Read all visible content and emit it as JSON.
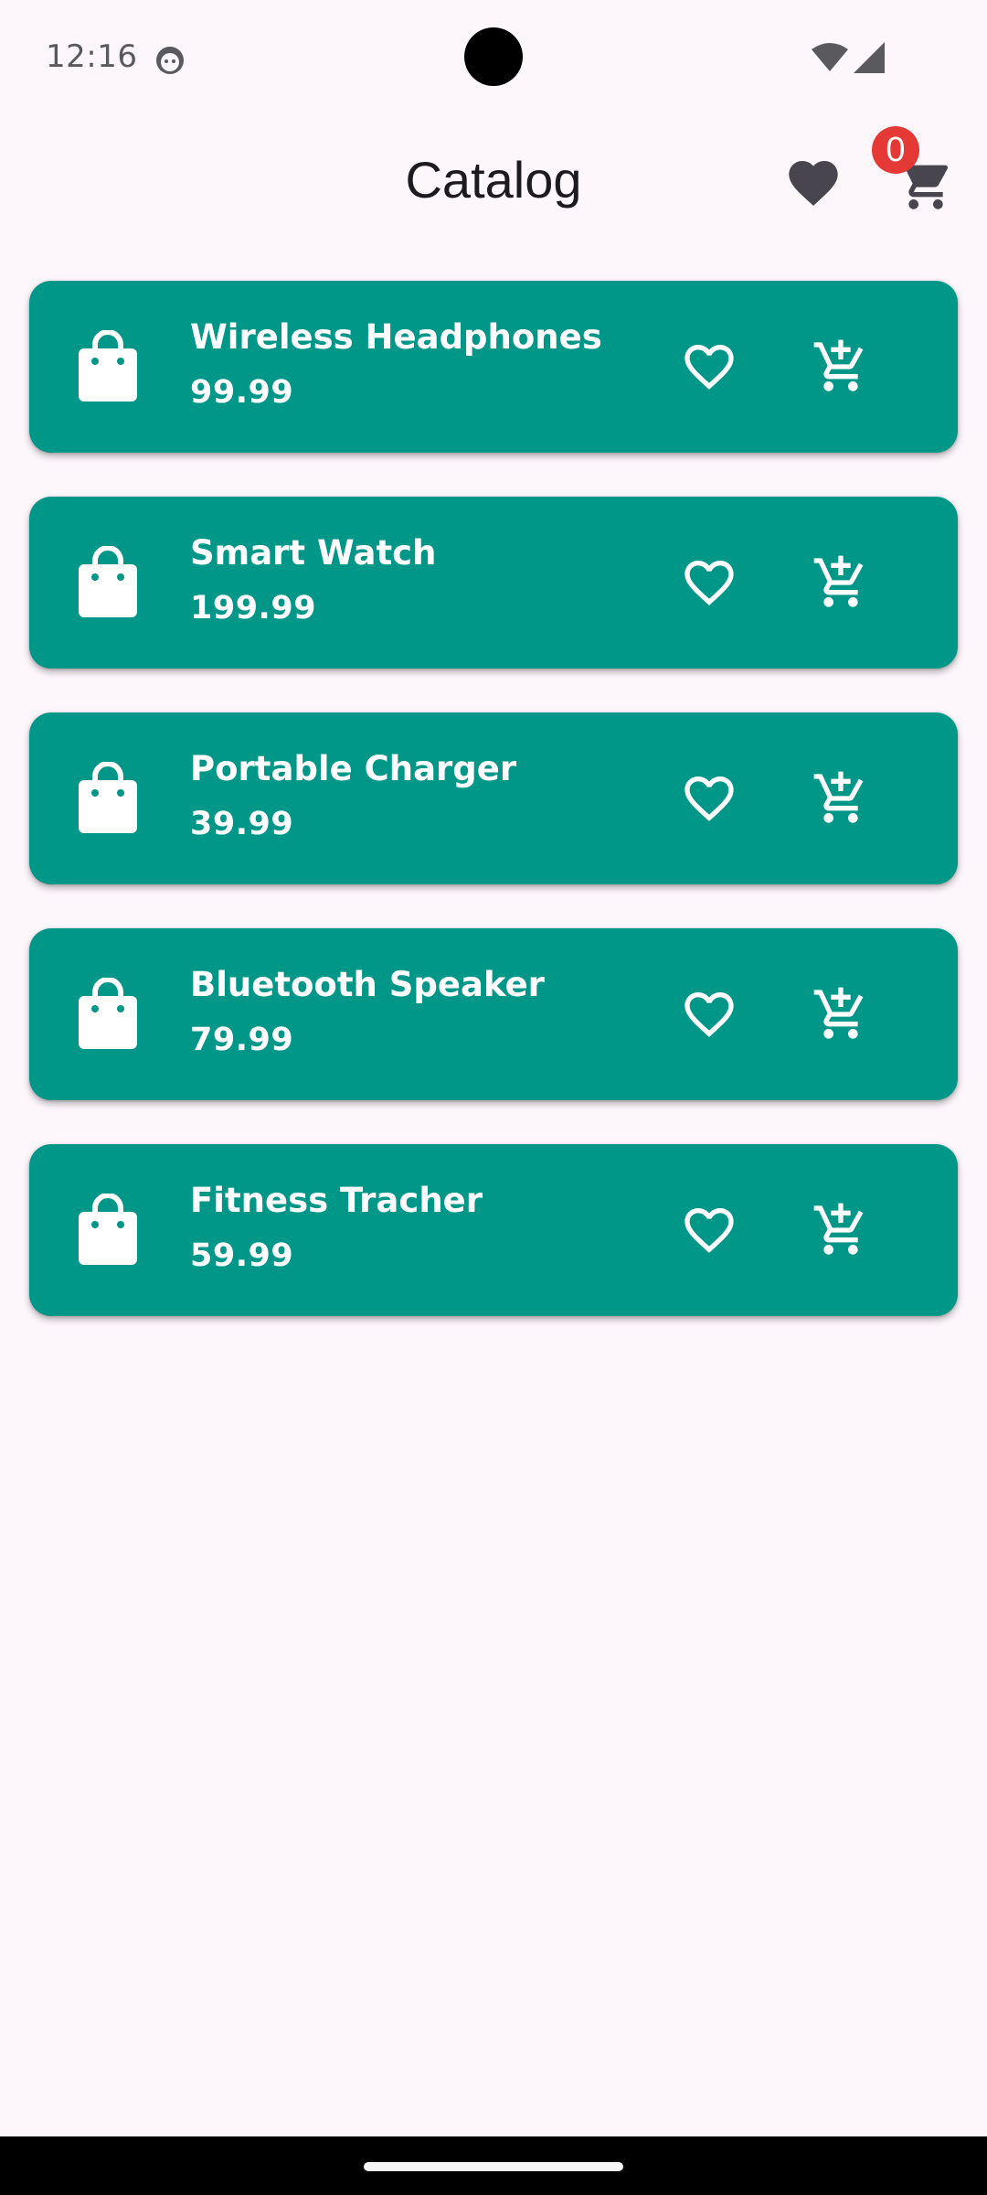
{
  "status_bar": {
    "time": "12:16",
    "icons": [
      "face-notification-icon",
      "wifi-icon",
      "cellular-signal-icon"
    ]
  },
  "header": {
    "title": "Catalog",
    "favorites_icon": "heart-filled-icon",
    "cart_icon": "shopping-cart-icon",
    "cart_count": "0"
  },
  "colors": {
    "card_background": "#009688",
    "page_background": "#fdf7fc",
    "badge": "#e53935",
    "icon_dark": "#49454f"
  },
  "products": [
    {
      "name": "Wireless Headphones",
      "price": "99.99"
    },
    {
      "name": "Smart Watch",
      "price": "199.99"
    },
    {
      "name": "Portable Charger",
      "price": "39.99"
    },
    {
      "name": "Bluetooth Speaker",
      "price": "79.99"
    },
    {
      "name": "Fitness Tracher",
      "price": "59.99"
    }
  ]
}
